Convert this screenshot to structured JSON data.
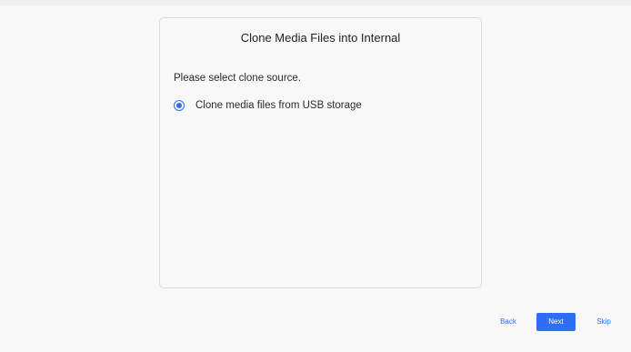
{
  "dialog": {
    "title": "Clone Media Files into Internal",
    "prompt": "Please select clone source.",
    "options": [
      {
        "label": "Clone media files from USB storage",
        "selected": true
      }
    ]
  },
  "footer": {
    "back_label": "Back",
    "next_label": "Next",
    "skip_label": "Skip"
  },
  "colors": {
    "accent": "#2f6ef2",
    "background": "#f8f8f8",
    "outer_background": "#f0f0f0",
    "dialog_border": "#dcdcdc"
  }
}
